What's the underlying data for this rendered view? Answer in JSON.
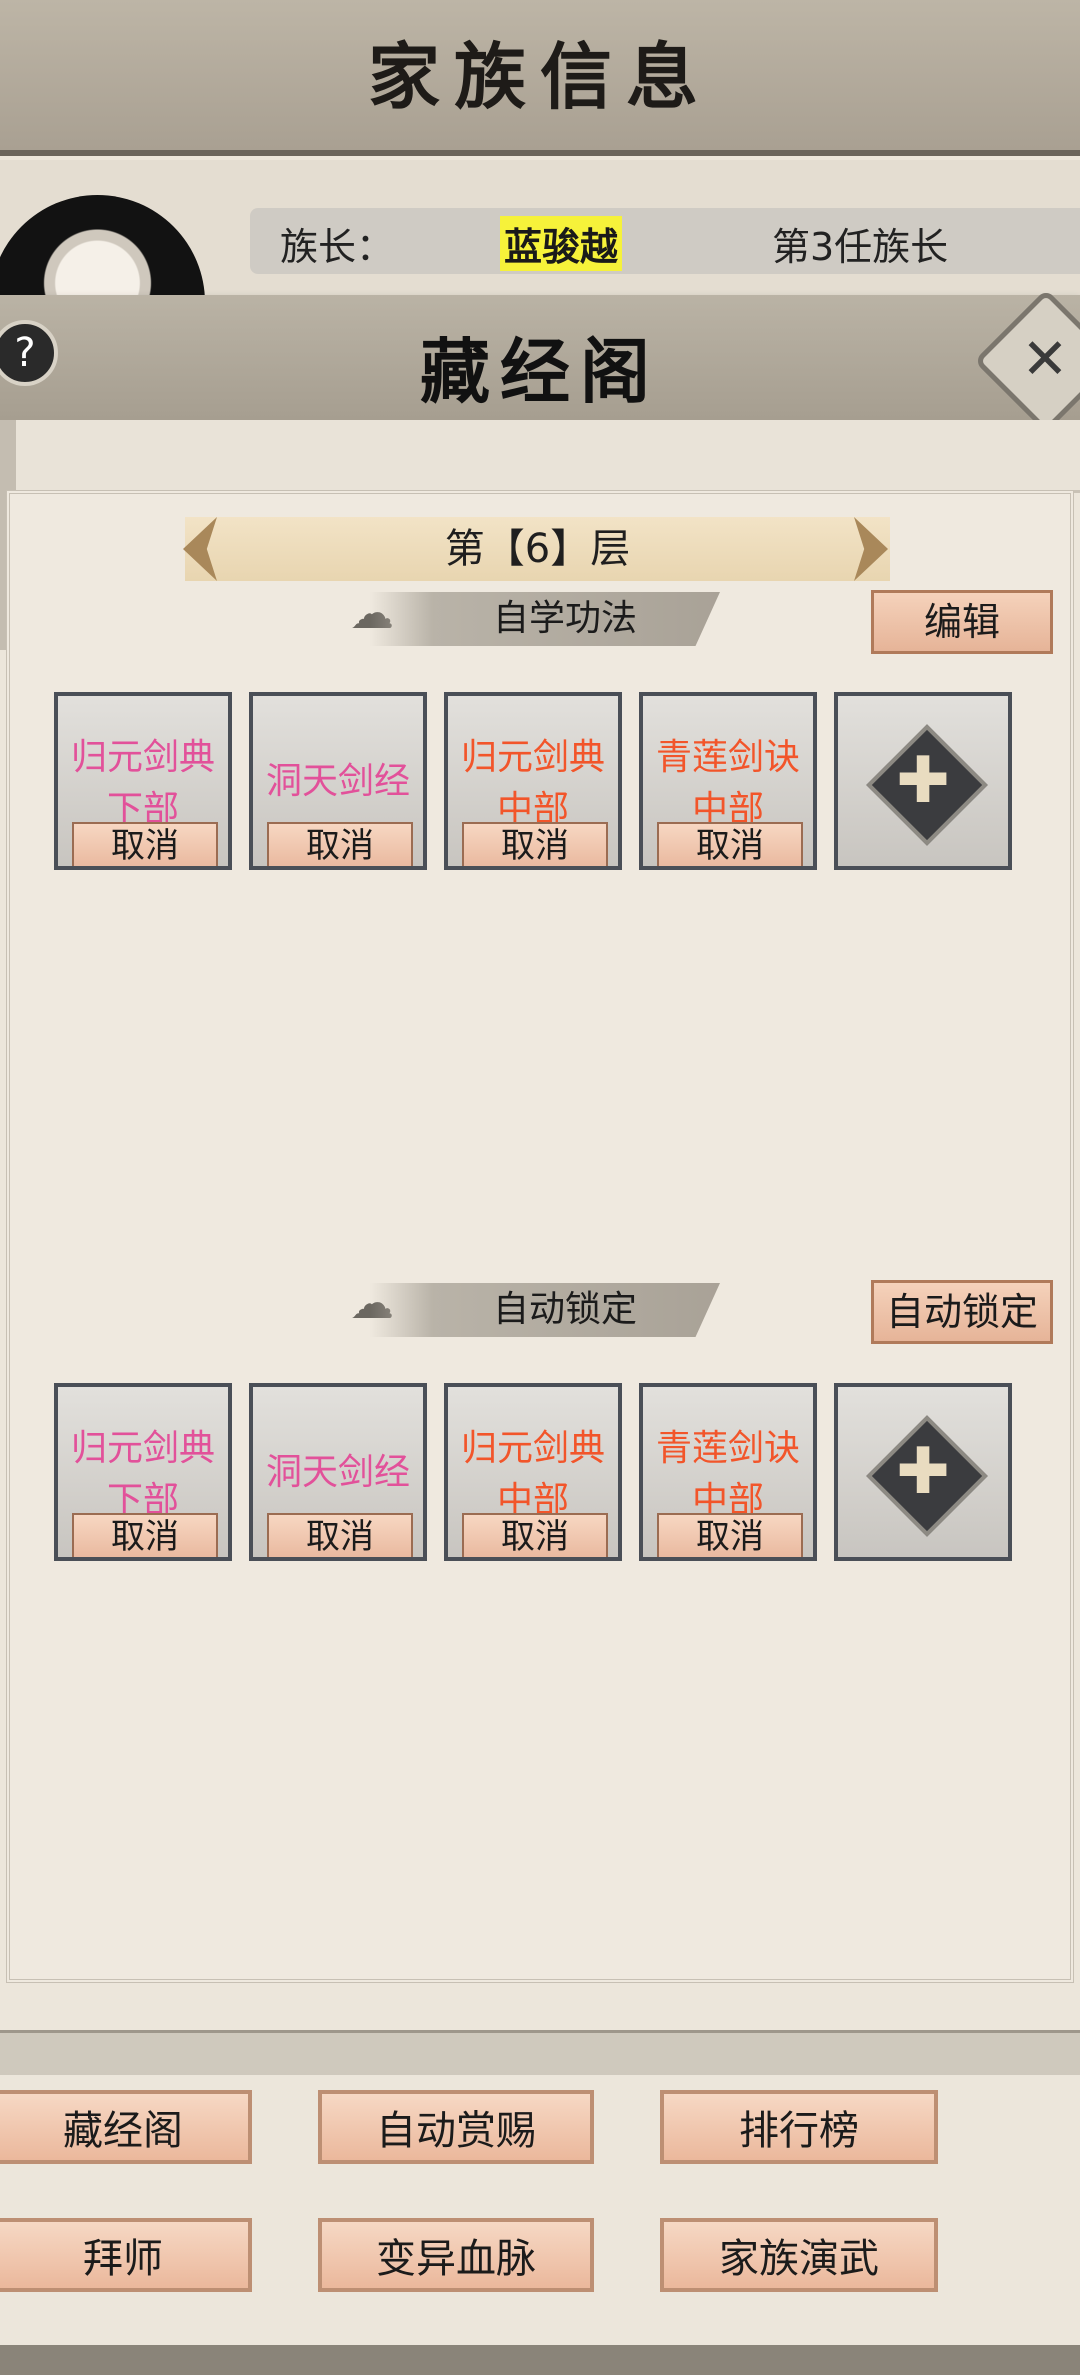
{
  "header": {
    "title": "家族信息"
  },
  "leader": {
    "label": "族长：",
    "name": "蓝骏越",
    "rank": "第3任族长"
  },
  "dialog": {
    "title": "藏经阁",
    "help": "?",
    "close": "✕"
  },
  "floor": {
    "label": "第【6】层"
  },
  "self_study": {
    "tag": "自学功法",
    "edit_button": "编辑",
    "slots": [
      {
        "name": "归元剑典下部",
        "color": "#e2519a",
        "cancel": "取消"
      },
      {
        "name": "洞天剑经",
        "color": "#e2519a",
        "cancel": "取消"
      },
      {
        "name": "归元剑典中部",
        "color": "#f2552a",
        "cancel": "取消"
      },
      {
        "name": "青莲剑诀中部",
        "color": "#f2552a",
        "cancel": "取消"
      }
    ],
    "add_icon": "plus-icon"
  },
  "auto_lock": {
    "tag": "自动锁定",
    "lock_button": "自动锁定",
    "slots": [
      {
        "name": "归元剑典下部",
        "color": "#e2519a",
        "cancel": "取消"
      },
      {
        "name": "洞天剑经",
        "color": "#e2519a",
        "cancel": "取消"
      },
      {
        "name": "归元剑典中部",
        "color": "#f2552a",
        "cancel": "取消"
      },
      {
        "name": "青莲剑诀中部",
        "color": "#f2552a",
        "cancel": "取消"
      }
    ],
    "add_icon": "plus-icon"
  },
  "nav": {
    "row1": [
      "藏经阁",
      "自动赏赐",
      "排行榜"
    ],
    "row2": [
      "拜师",
      "变异血脉",
      "家族演武"
    ]
  }
}
